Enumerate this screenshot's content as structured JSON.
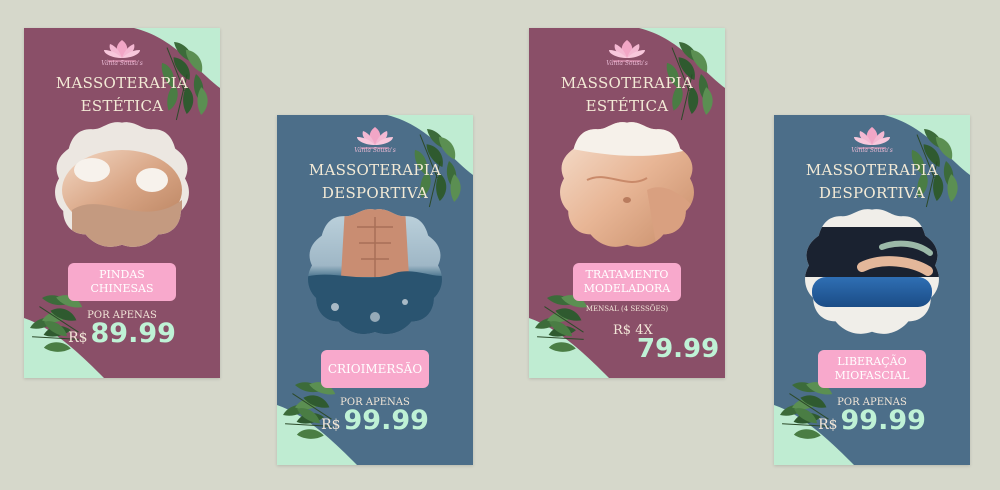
{
  "colors": {
    "background": "#d6d8cb",
    "mauve": "#8a4f68",
    "slate": "#4c6e89",
    "mint": "#bfecd2",
    "pink": "#f8a9cc",
    "leaf": "#3c6b3a"
  },
  "cards": [
    {
      "logo_text": "Vânia Sousa's",
      "title": "MASSOTERAPIA ESTÉTICA",
      "treatment": "PINDAS\nCHINESAS",
      "price_prefix": "POR APENAS",
      "currency": "R$",
      "price": "89.99"
    },
    {
      "logo_text": "Vânia Sousa's",
      "title": "MASSOTERAPIA DESPORTIVA",
      "treatment": "CRIOIMERSÃO",
      "price_prefix": "POR APENAS",
      "currency": "R$",
      "price": "99.99"
    },
    {
      "logo_text": "Vânia Sousa's",
      "title": "MASSOTERAPIA ESTÉTICA",
      "treatment": "TRATAMENTO\nMODELADORA",
      "note": "MENSAL (4 SESSÕES)",
      "currency_line": "R$   4X",
      "price": "79.99"
    },
    {
      "logo_text": "Vânia Sousa's",
      "title": "MASSOTERAPIA DESPORTIVA",
      "treatment": "LIBERAÇÃO\nMIOFASCIAL",
      "price_prefix": "POR APENAS",
      "currency": "R$",
      "price": "99.99"
    }
  ]
}
